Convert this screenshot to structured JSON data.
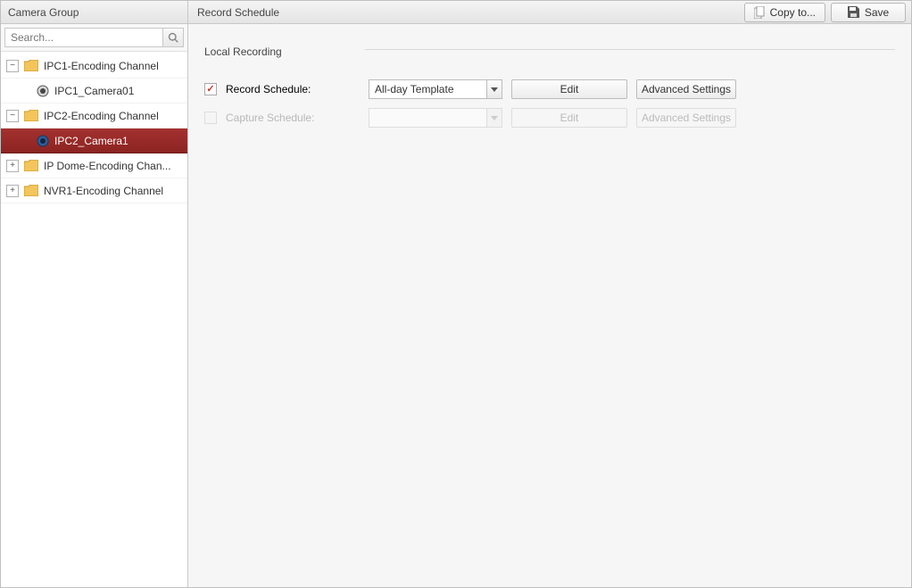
{
  "sidebar": {
    "title": "Camera Group",
    "search_placeholder": "Search...",
    "nodes": [
      {
        "label": "IPC1-Encoding Channel",
        "expander": "−"
      },
      {
        "label": "IPC1_Camera01"
      },
      {
        "label": "IPC2-Encoding Channel",
        "expander": "−"
      },
      {
        "label": "IPC2_Camera1"
      },
      {
        "label": "IP Dome-Encoding Chan...",
        "expander": "+"
      },
      {
        "label": "NVR1-Encoding Channel",
        "expander": "+"
      }
    ]
  },
  "header": {
    "title": "Record Schedule",
    "copy_label": "Copy to...",
    "save_label": "Save"
  },
  "form": {
    "section_title": "Local Recording",
    "record_label": "Record Schedule:",
    "capture_label": "Capture Schedule:",
    "template_value": "All-day Template",
    "edit_label": "Edit",
    "advanced_label": "Advanced Settings"
  }
}
